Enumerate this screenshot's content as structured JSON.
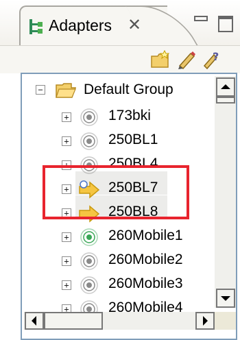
{
  "view": {
    "tab_title": "Adapters",
    "tab_close_glyph": "✕",
    "tab_icon": "adapters-tree-icon"
  },
  "toolbar": {
    "buttons": [
      {
        "icon": "new-folder-icon"
      },
      {
        "icon": "edit-pencil-icon"
      },
      {
        "icon": "help-query-icon"
      }
    ]
  },
  "tree": {
    "group": {
      "label": "Default Group",
      "expanded": true,
      "expander": "⊟"
    },
    "items": [
      {
        "label": "173bki",
        "status": "inactive"
      },
      {
        "label": "250BL1",
        "status": "inactive"
      },
      {
        "label": "250BL4",
        "status": "inactive"
      },
      {
        "label": "250BL7",
        "status": "arrow-new"
      },
      {
        "label": "250BL8",
        "status": "arrow"
      },
      {
        "label": "260Mobile1",
        "status": "active"
      },
      {
        "label": "260Mobile2",
        "status": "inactive"
      },
      {
        "label": "260Mobile3",
        "status": "inactive"
      },
      {
        "label": "260Mobile4",
        "status": "inactive"
      }
    ],
    "expander_glyph": "+"
  },
  "colors": {
    "highlight_box": "#e8242e",
    "active_adapter": "#3aa757",
    "inactive_adapter": "#8a8a8a",
    "arrow": "#f5c542",
    "tree_border": "#7f9db9"
  }
}
